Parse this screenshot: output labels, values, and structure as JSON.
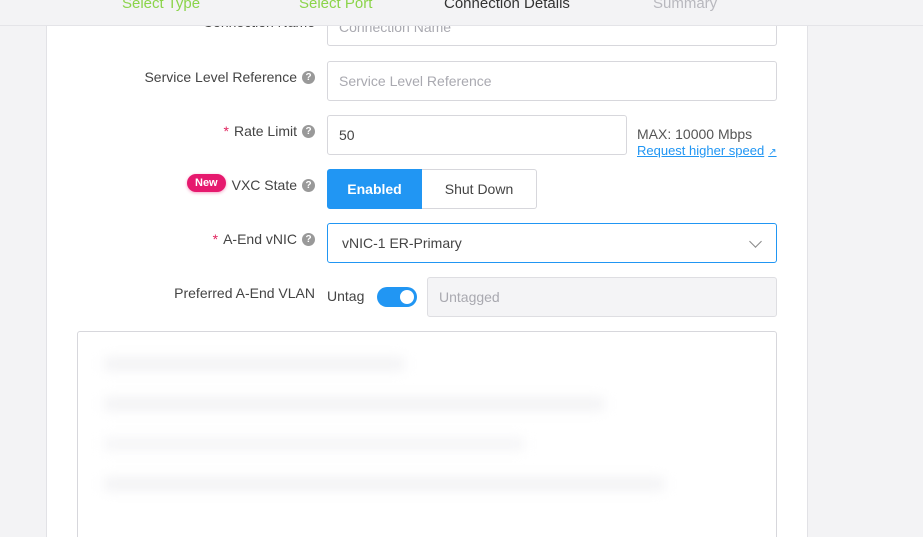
{
  "steps": [
    {
      "label": "Select Type",
      "state": "done"
    },
    {
      "label": "Select Port",
      "state": "done"
    },
    {
      "label": "Connection Details",
      "state": "active"
    },
    {
      "label": "Summary",
      "state": "todo"
    }
  ],
  "form": {
    "connection_name": {
      "label": "Connection Name",
      "placeholder": "Connection Name"
    },
    "service_level_reference": {
      "label": "Service Level Reference",
      "placeholder": "Service Level Reference"
    },
    "rate_limit": {
      "label": "Rate Limit",
      "value": "50",
      "max_text": "MAX: 10000 Mbps",
      "link": "Request higher speed"
    },
    "vxc_state": {
      "badge": "New",
      "label": "VXC State",
      "options": [
        "Enabled",
        "Shut Down"
      ],
      "selected": "Enabled"
    },
    "a_end_vnic": {
      "label": "A-End vNIC",
      "value": "vNIC-1 ER-Primary"
    },
    "preferred_vlan": {
      "label": "Preferred A-End VLAN",
      "untag_label": "Untag",
      "untag_on": true,
      "placeholder": "Untagged"
    }
  },
  "colors": {
    "accent": "#2196f3",
    "done_step": "#8bd44a",
    "badge": "#e6196e",
    "required": "#e0245e"
  }
}
